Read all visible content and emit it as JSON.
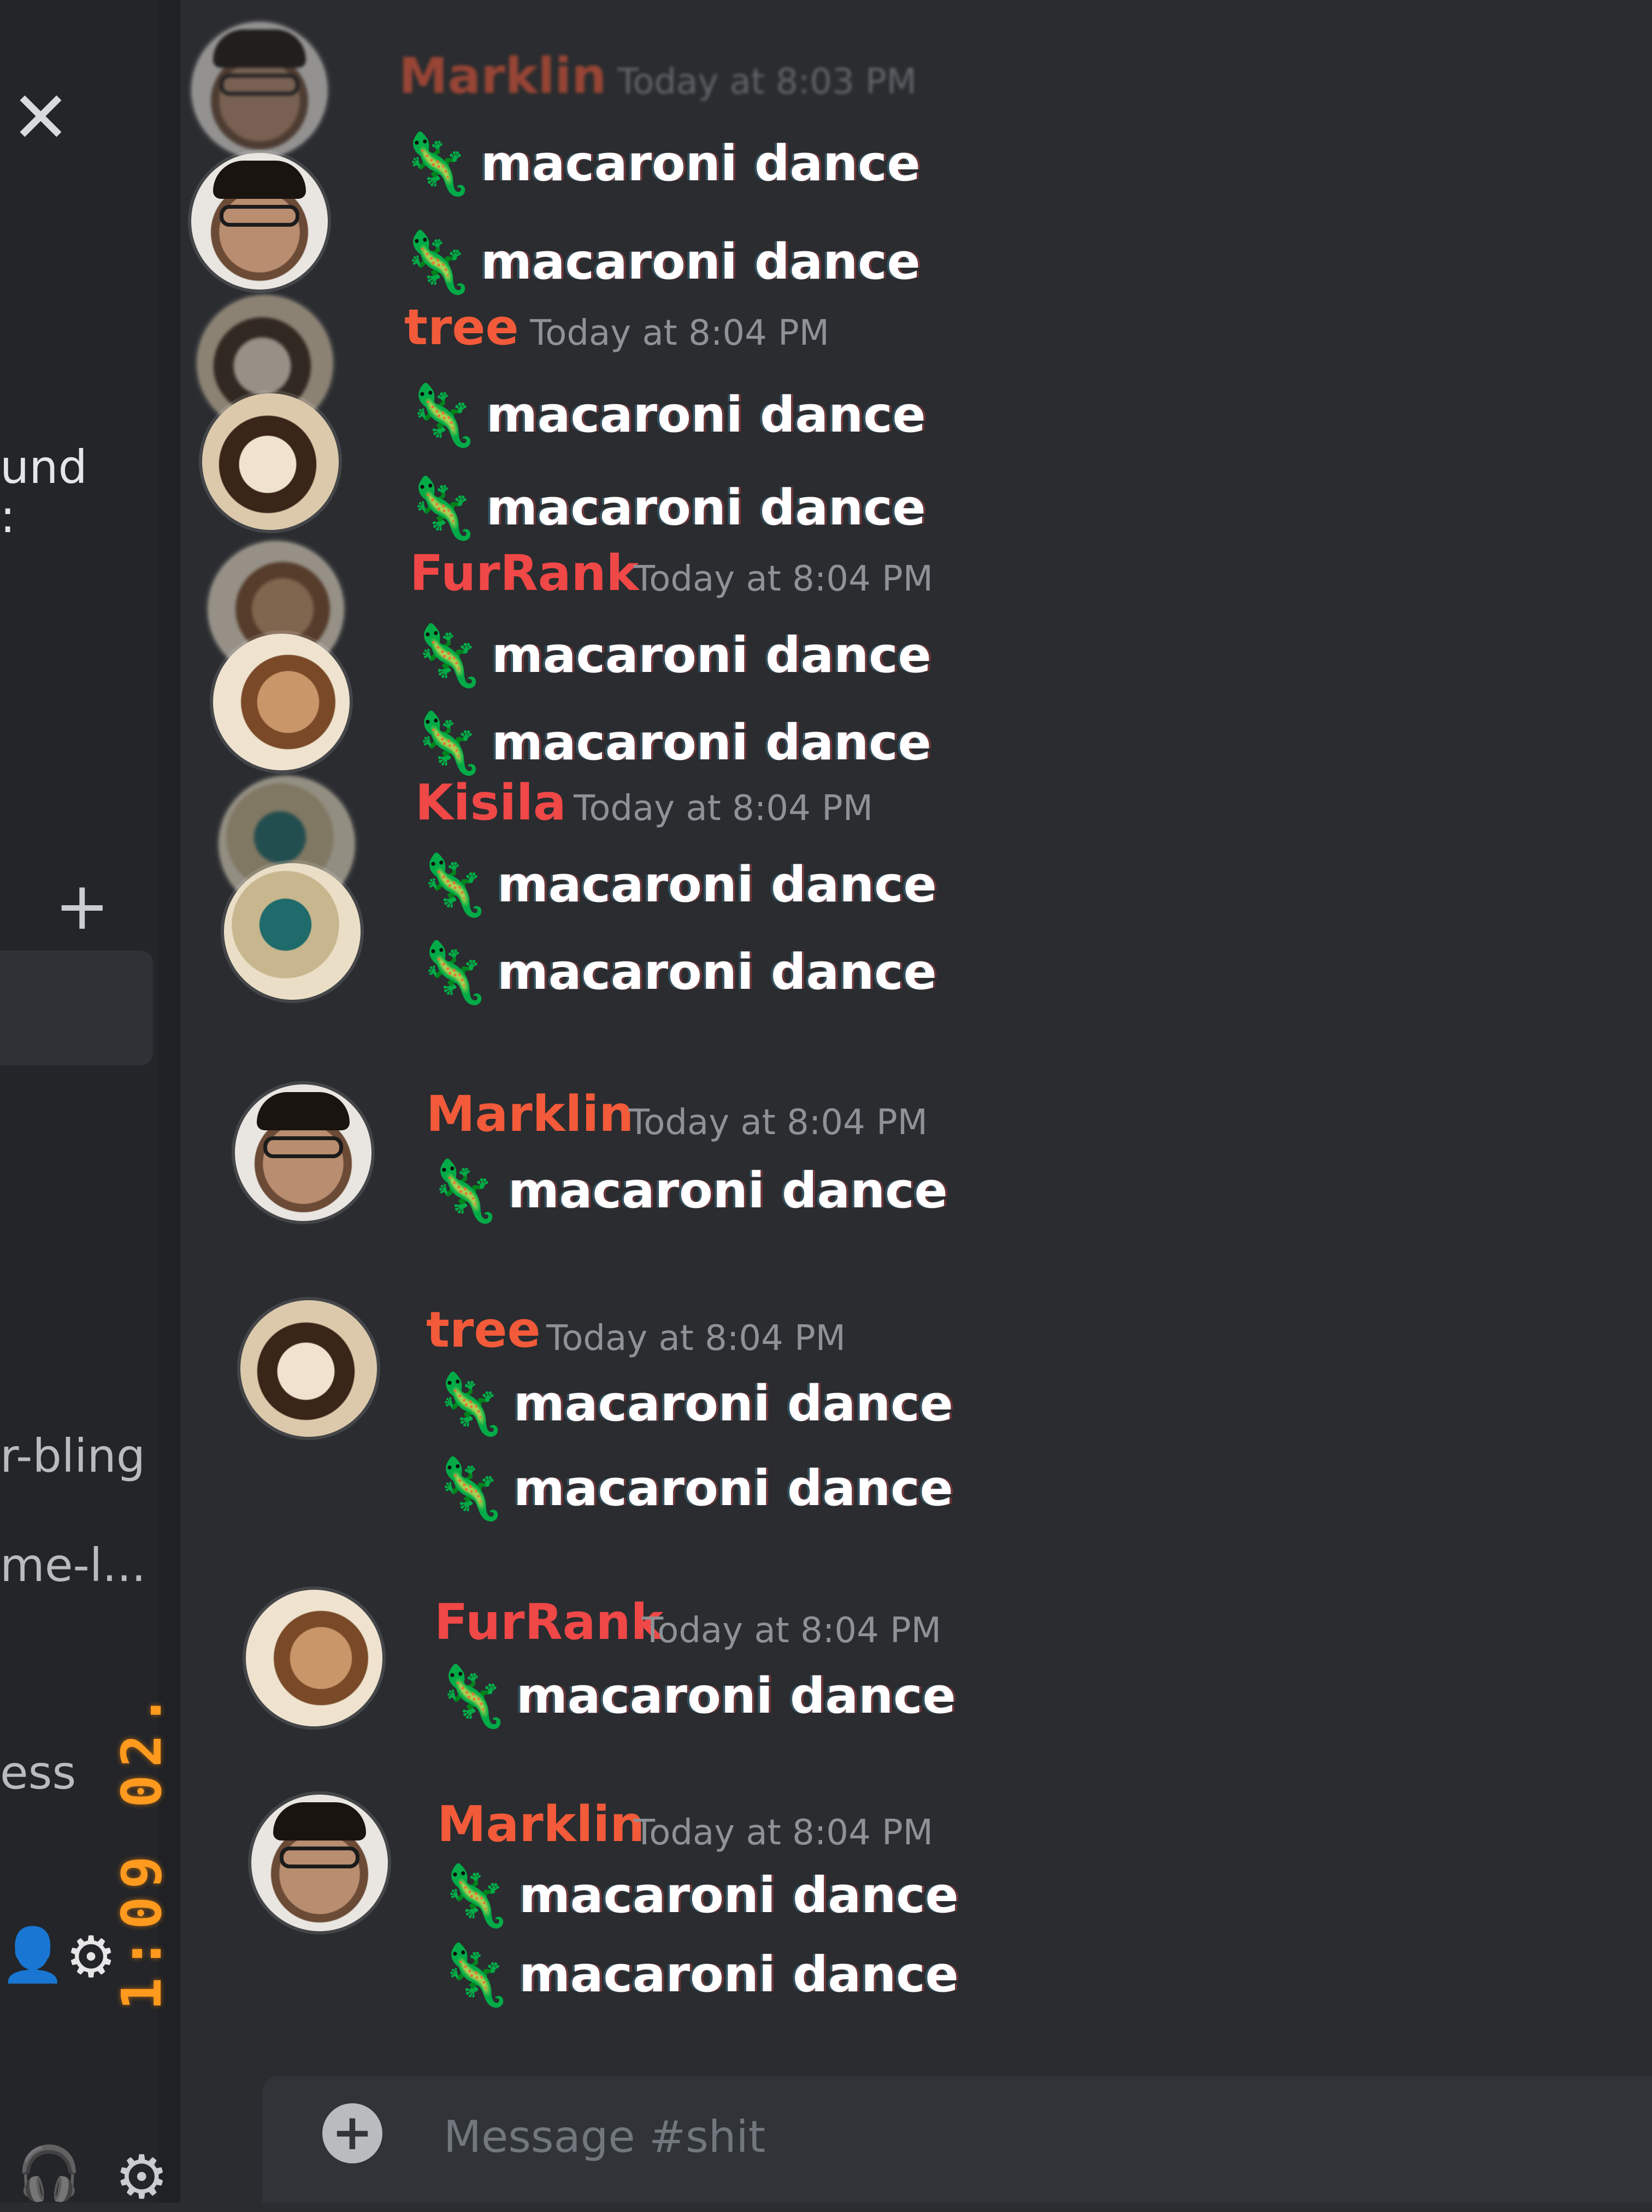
{
  "sidebar": {
    "fragments": {
      "und": "und",
      "colon": ":",
      "bling": "r-bling",
      "me": "me-l...",
      "ess": "ess"
    },
    "icons": {
      "close": "close-icon",
      "add": "add-icon",
      "add_user": "add-user-icon",
      "settings": "gear-icon",
      "headset": "headset-icon"
    }
  },
  "clock": {
    "text": "1:09 02."
  },
  "emoji_name": "lizard",
  "messages": [
    {
      "author": "Marklin",
      "timestamp": "Today at 8:03 PM",
      "lines": [
        "macaroni dance"
      ]
    },
    {
      "author": "tree",
      "timestamp": "Today at 8:04 PM",
      "lines": [
        "macaroni dance"
      ]
    },
    {
      "author": "FurRank",
      "timestamp": "Today at 8:04 PM",
      "lines": [
        "macaroni dance"
      ]
    },
    {
      "author": "Kisila",
      "timestamp": "Today at 8:04 PM",
      "lines": [
        "macaroni dance"
      ]
    },
    {
      "author": "Marklin",
      "timestamp": "Today at 8:04 PM",
      "lines": [
        "macaroni dance"
      ]
    },
    {
      "author": "tree",
      "timestamp": "Today at 8:04 PM",
      "lines": [
        "macaroni dance",
        "macaroni dance"
      ]
    },
    {
      "author": "FurRank",
      "timestamp": "Today at 8:04 PM",
      "lines": [
        "macaroni dance"
      ]
    },
    {
      "author": "Marklin",
      "timestamp": "Today at 8:04 PM",
      "lines": [
        "macaroni dance",
        "macaroni dance"
      ]
    }
  ],
  "composer": {
    "placeholder": "Message #shit"
  },
  "colors": {
    "background": "#2a2c2f",
    "username_red": "#f04747",
    "timestamp": "#8e9297",
    "emoji_green": "#5fd34a",
    "clock_orange": "#ff9a1f"
  }
}
